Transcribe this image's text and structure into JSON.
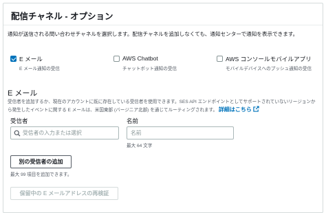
{
  "panel": {
    "title": "配信チャネル - オプション"
  },
  "description": "通知が送信される問い合わせチャネルを選択します。配信チャネルを追加しなくても、通知センターで通知を表示できます。",
  "channels": [
    {
      "label": "E メール",
      "sublabel": "E メール通知の受信",
      "checked": true
    },
    {
      "label": "AWS Chatbot",
      "sublabel": "チャットボット通知の受信",
      "checked": false
    },
    {
      "label": "AWS コンソールモバイルアプリ",
      "sublabel": "モバイルデバイスへのプッシュ通知の受信",
      "checked": false
    }
  ],
  "email_section": {
    "title": "E メール",
    "description": "受信者を追加するか、現在のアカウントに既に存在している受信者を使用できます。SES API エンドポイントとしてサポートされていないリージョンから発生したイベントに関する E メールは、米国東部 (バージニア北部) を通じてルーティングされます。",
    "link_label": "詳細はこちら",
    "recipient_label": "受信者",
    "recipient_placeholder": "受信者の入力または選択",
    "recipient_value": "",
    "name_label": "名前",
    "name_placeholder": "名前",
    "name_value": "",
    "name_hint": "最大 64 文字",
    "add_button_label": "別の受信者の追加",
    "add_hint": "最大 99 項目を追加できます。",
    "reverify_button_label": "保留中の E メールアドレスの再検証"
  },
  "colors": {
    "accent": "#0073bb",
    "text": "#16191f",
    "muted": "#545b64",
    "border": "#aab7b8"
  },
  "icons": {
    "search": "search-icon",
    "external": "external-link-icon",
    "check": "checkmark-icon"
  }
}
